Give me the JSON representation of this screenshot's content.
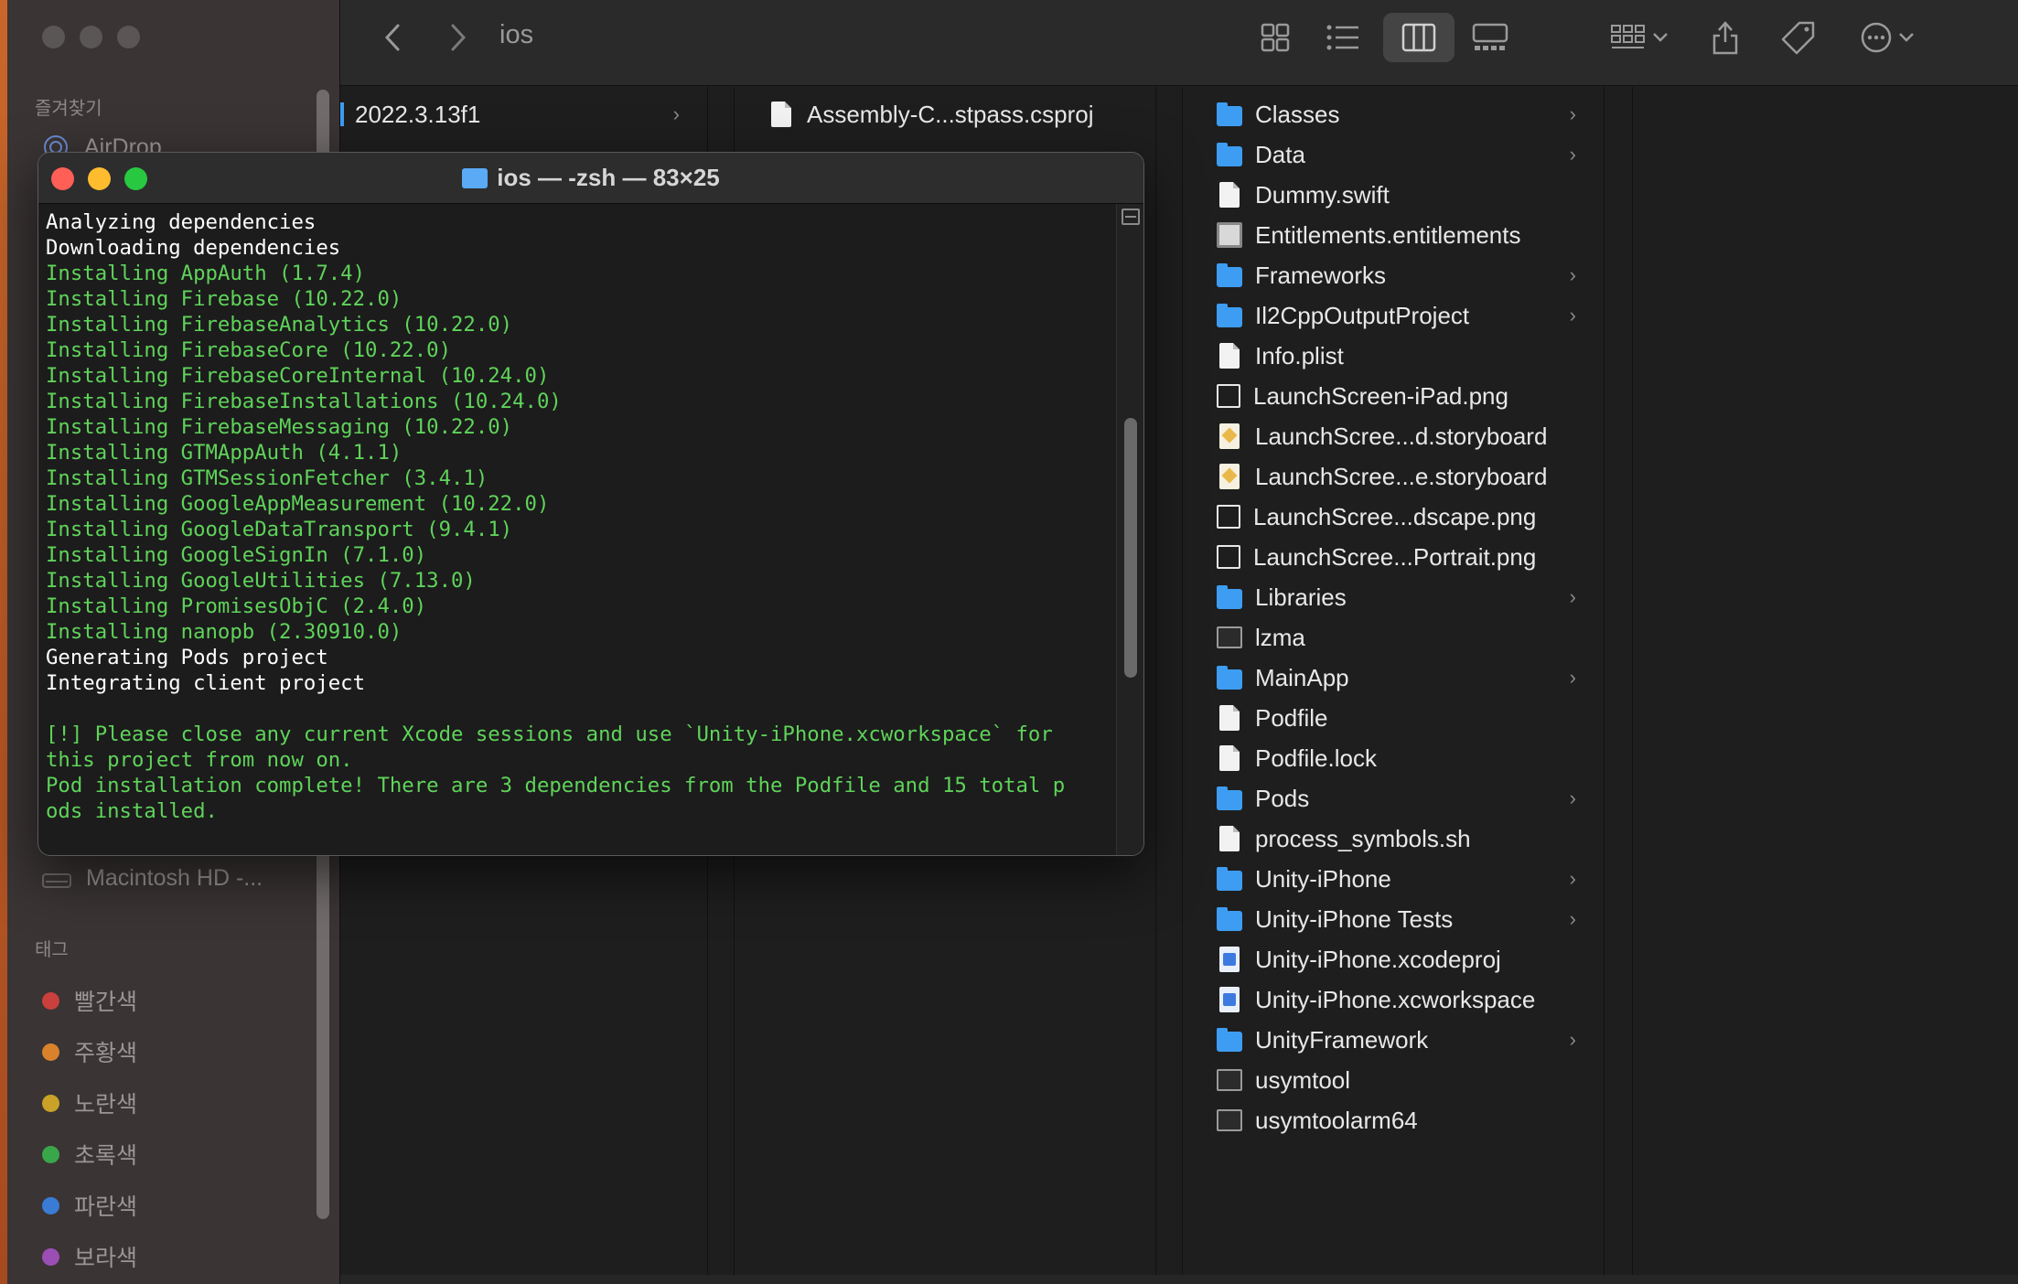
{
  "finder": {
    "path_title": "ios",
    "sidebar": {
      "favorites_header": "즐겨찾기",
      "airdrop_label": "AirDrop",
      "disk_label": "Macintosh HD -...",
      "tags_header": "태그",
      "tags": [
        {
          "label": "빨간색",
          "color": "#c9403d"
        },
        {
          "label": "주황색",
          "color": "#d9822b"
        },
        {
          "label": "노란색",
          "color": "#c9a227"
        },
        {
          "label": "초록색",
          "color": "#3aa64a"
        },
        {
          "label": "파란색",
          "color": "#3a7bd5"
        },
        {
          "label": "보라색",
          "color": "#9b4fb5"
        }
      ]
    },
    "columns": {
      "col1_item": "2022.3.13f1",
      "col2_item": "Assembly-C...stpass.csproj",
      "col3_items": [
        {
          "name": "Classes",
          "icon": "folder-icon",
          "chevron": true
        },
        {
          "name": "Data",
          "icon": "folder-icon",
          "chevron": true
        },
        {
          "name": "Dummy.swift",
          "icon": "document-icon",
          "chevron": false
        },
        {
          "name": "Entitlements.entitlements",
          "icon": "entitlements-icon",
          "chevron": false
        },
        {
          "name": "Frameworks",
          "icon": "folder-icon",
          "chevron": true
        },
        {
          "name": "Il2CppOutputProject",
          "icon": "folder-icon",
          "chevron": true
        },
        {
          "name": "Info.plist",
          "icon": "document-icon",
          "chevron": false
        },
        {
          "name": "LaunchScreen-iPad.png",
          "icon": "image-icon",
          "chevron": false
        },
        {
          "name": "LaunchScree...d.storyboard",
          "icon": "storyboard-icon",
          "chevron": false
        },
        {
          "name": "LaunchScree...e.storyboard",
          "icon": "storyboard-icon",
          "chevron": false
        },
        {
          "name": "LaunchScree...dscape.png",
          "icon": "image-icon",
          "chevron": false
        },
        {
          "name": "LaunchScree...Portrait.png",
          "icon": "image-icon",
          "chevron": false
        },
        {
          "name": "Libraries",
          "icon": "folder-icon",
          "chevron": true
        },
        {
          "name": "lzma",
          "icon": "executable-icon",
          "chevron": false
        },
        {
          "name": "MainApp",
          "icon": "folder-icon",
          "chevron": true
        },
        {
          "name": "Podfile",
          "icon": "document-icon",
          "chevron": false
        },
        {
          "name": "Podfile.lock",
          "icon": "document-icon",
          "chevron": false
        },
        {
          "name": "Pods",
          "icon": "folder-icon",
          "chevron": true
        },
        {
          "name": "process_symbols.sh",
          "icon": "document-icon",
          "chevron": false
        },
        {
          "name": "Unity-iPhone",
          "icon": "folder-icon",
          "chevron": true
        },
        {
          "name": "Unity-iPhone Tests",
          "icon": "folder-icon",
          "chevron": true
        },
        {
          "name": "Unity-iPhone.xcodeproj",
          "icon": "xcodeproj-icon",
          "chevron": false
        },
        {
          "name": "Unity-iPhone.xcworkspace",
          "icon": "xcworkspace-icon",
          "chevron": false
        },
        {
          "name": "UnityFramework",
          "icon": "folder-icon",
          "chevron": true
        },
        {
          "name": "usymtool",
          "icon": "executable-icon",
          "chevron": false
        },
        {
          "name": "usymtoolarm64",
          "icon": "executable-icon",
          "chevron": false
        }
      ]
    }
  },
  "terminal": {
    "title": "ios — -zsh — 83×25",
    "lines": [
      {
        "text": "Analyzing dependencies",
        "color": "white"
      },
      {
        "text": "Downloading dependencies",
        "color": "white"
      },
      {
        "text": "Installing AppAuth (1.7.4)",
        "color": "green"
      },
      {
        "text": "Installing Firebase (10.22.0)",
        "color": "green"
      },
      {
        "text": "Installing FirebaseAnalytics (10.22.0)",
        "color": "green"
      },
      {
        "text": "Installing FirebaseCore (10.22.0)",
        "color": "green"
      },
      {
        "text": "Installing FirebaseCoreInternal (10.24.0)",
        "color": "green"
      },
      {
        "text": "Installing FirebaseInstallations (10.24.0)",
        "color": "green"
      },
      {
        "text": "Installing FirebaseMessaging (10.22.0)",
        "color": "green"
      },
      {
        "text": "Installing GTMAppAuth (4.1.1)",
        "color": "green"
      },
      {
        "text": "Installing GTMSessionFetcher (3.4.1)",
        "color": "green"
      },
      {
        "text": "Installing GoogleAppMeasurement (10.22.0)",
        "color": "green"
      },
      {
        "text": "Installing GoogleDataTransport (9.4.1)",
        "color": "green"
      },
      {
        "text": "Installing GoogleSignIn (7.1.0)",
        "color": "green"
      },
      {
        "text": "Installing GoogleUtilities (7.13.0)",
        "color": "green"
      },
      {
        "text": "Installing PromisesObjC (2.4.0)",
        "color": "green"
      },
      {
        "text": "Installing nanopb (2.30910.0)",
        "color": "green"
      },
      {
        "text": "Generating Pods project",
        "color": "white"
      },
      {
        "text": "Integrating client project",
        "color": "white"
      },
      {
        "text": "",
        "color": "white"
      },
      {
        "text": "[!] Please close any current Xcode sessions and use `Unity-iPhone.xcworkspace` for",
        "color": "green"
      },
      {
        "text": "this project from now on.",
        "color": "green"
      },
      {
        "text": "Pod installation complete! There are 3 dependencies from the Podfile and 15 total p",
        "color": "green"
      },
      {
        "text": "ods installed.",
        "color": "green"
      }
    ]
  },
  "colors": {
    "terminal_green": "#5fd35a",
    "folder_blue": "#3d9df3",
    "close_red": "#ff5f57",
    "minimize_yellow": "#febc2e",
    "zoom_green": "#28c840"
  }
}
